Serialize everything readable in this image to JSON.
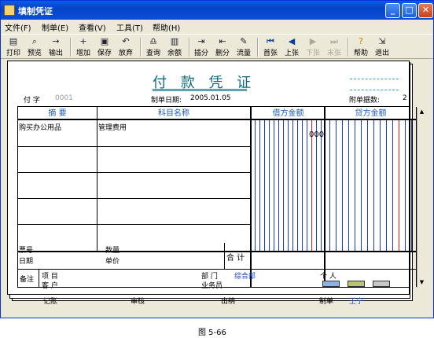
{
  "window": {
    "title": "填制凭证"
  },
  "menu": [
    "文件(F)",
    "制单(E)",
    "查看(V)",
    "工具(T)",
    "帮助(H)"
  ],
  "toolbar": {
    "print": "打印",
    "preview": "预览",
    "export": "输出",
    "add": "增加",
    "save": "保存",
    "discard": "放弃",
    "query": "查询",
    "balance": "余额",
    "insert": "插分",
    "delete": "删分",
    "flow": "流量",
    "first": "首张",
    "prev": "上张",
    "next": "下张",
    "last": "末张",
    "help": "帮助",
    "exit": "退出"
  },
  "voucher": {
    "title": "付 款 凭 证",
    "type_label": "付 字",
    "number": "0001",
    "date_label": "制单日期:",
    "date": "2005.01.05",
    "attach_label": "附单据数:",
    "attach_count": "2",
    "col_summary": "摘 要",
    "col_account": "科目名称",
    "col_debit": "借方金额",
    "col_credit": "贷方金额",
    "rows": [
      {
        "summary": "购买办公用品",
        "account": "管理费用",
        "debit": "000"
      }
    ],
    "ticket_no": "票号",
    "date2": "日期",
    "qty": "数量",
    "price": "单价",
    "total": "合 计",
    "remark": "备注",
    "project": "项 目",
    "customer": "客 户",
    "dept_label": "部 门",
    "dept": "综合部",
    "person": "个 人",
    "salesman": "业务员",
    "bookkeeping": "记账",
    "audit": "审核",
    "cashier": "出纳",
    "maker_label": "制单",
    "maker": "王宁"
  },
  "caption": "图 5-66"
}
